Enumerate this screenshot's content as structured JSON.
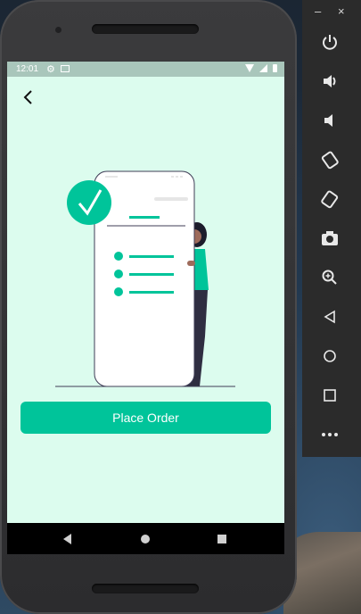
{
  "status_bar": {
    "time": "12:01",
    "icons": [
      "gear-icon",
      "mail-icon",
      "wifi-icon",
      "signal-icon",
      "battery-icon"
    ]
  },
  "screen": {
    "back_icon": "chevron-left-icon",
    "place_order_label": "Place Order",
    "illustration": "order-confirmation-illustration"
  },
  "nav_bar": {
    "items": [
      "nav-back-icon",
      "nav-home-icon",
      "nav-recents-icon"
    ]
  },
  "emulator_toolbar": {
    "minimize_label": "–",
    "close_label": "×",
    "buttons": [
      "power-icon",
      "volume-up-icon",
      "volume-down-icon",
      "rotate-left-icon",
      "rotate-right-icon",
      "camera-icon",
      "zoom-icon",
      "back-icon",
      "home-icon",
      "overview-icon",
      "more-icon"
    ]
  },
  "colors": {
    "accent": "#00c49a",
    "screen_bg": "#dcfcee",
    "status_bar_bg": "#a9c6bb",
    "toolbar_bg": "#2b2b2b"
  }
}
